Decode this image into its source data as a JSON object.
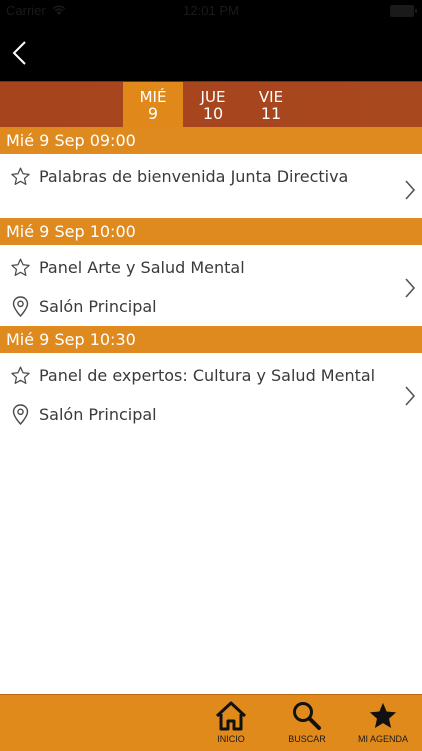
{
  "status_bar": {
    "carrier": "Carrier",
    "time": "12:01 PM"
  },
  "day_tabs": [
    {
      "dow": "MIÉ",
      "num": "9",
      "active": true
    },
    {
      "dow": "JUE",
      "num": "10",
      "active": false
    },
    {
      "dow": "VIE",
      "num": "11",
      "active": false
    }
  ],
  "sections": [
    {
      "header": "Mié 9 Sep 09:00",
      "title": "Palabras de bienvenida Junta Directiva",
      "location": ""
    },
    {
      "header": "Mié 9 Sep 10:00",
      "title": "Panel Arte y Salud Mental",
      "location": "Salón Principal"
    },
    {
      "header": "Mié 9 Sep 10:30",
      "title": "Panel de expertos: Cultura y Salud Mental",
      "location": "Salón Principal"
    }
  ],
  "tab_bar": {
    "home_label": "INICIO",
    "search_label": "BUSCAR",
    "agenda_label": "MI AGENDA"
  },
  "icons": {
    "back": "chevron-left-icon",
    "favorite": "star-outline-icon",
    "location": "location-pin-icon",
    "disclosure": "chevron-right-icon",
    "home": "home-icon",
    "search": "search-icon",
    "agenda": "star-filled-icon"
  },
  "colors": {
    "accent_orange": "#de8a1f",
    "day_bar_brown": "#a6441d",
    "nav_black": "#000000"
  }
}
